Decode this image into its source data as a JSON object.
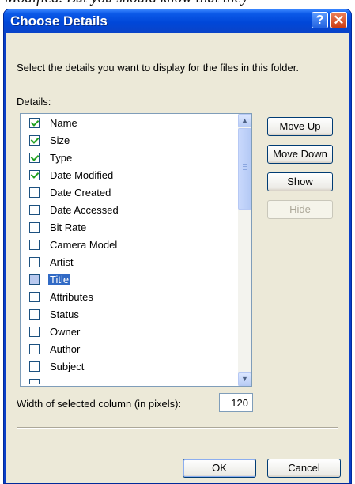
{
  "background_text": "Modified. But you should know that they",
  "dialog": {
    "title": "Choose Details",
    "description": "Select the details you want to display for the files in this folder.",
    "details_label": "Details:",
    "items": [
      {
        "label": "Name",
        "checked": true
      },
      {
        "label": "Size",
        "checked": true
      },
      {
        "label": "Type",
        "checked": true
      },
      {
        "label": "Date Modified",
        "checked": true
      },
      {
        "label": "Date Created",
        "checked": false
      },
      {
        "label": "Date Accessed",
        "checked": false
      },
      {
        "label": "Bit Rate",
        "checked": false
      },
      {
        "label": "Camera Model",
        "checked": false
      },
      {
        "label": "Artist",
        "checked": false
      },
      {
        "label": "Title",
        "checked": false,
        "selected": true
      },
      {
        "label": "Attributes",
        "checked": false
      },
      {
        "label": "Status",
        "checked": false
      },
      {
        "label": "Owner",
        "checked": false
      },
      {
        "label": "Author",
        "checked": false
      },
      {
        "label": "Subject",
        "checked": false
      }
    ],
    "buttons": {
      "move_up": "Move Up",
      "move_down": "Move Down",
      "show": "Show",
      "hide": "Hide",
      "ok": "OK",
      "cancel": "Cancel"
    },
    "width_label": "Width of selected column (in pixels):",
    "width_value": "120"
  },
  "colors": {
    "titlebar": "#0047d8",
    "selection": "#316ac5",
    "check": "#21a121"
  },
  "icons": {
    "help": "question-mark-icon",
    "close": "close-x-icon",
    "scroll_up": "chevron-up-icon",
    "scroll_down": "chevron-down-icon"
  }
}
